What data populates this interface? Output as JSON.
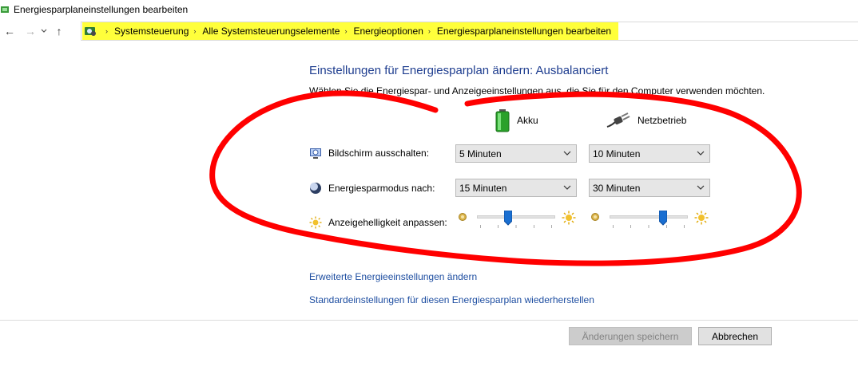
{
  "window": {
    "title": "Energiesparplaneinstellungen bearbeiten"
  },
  "nav": {
    "back": "←",
    "forward": "→",
    "recent": "⌄",
    "up": "↑"
  },
  "breadcrumb": {
    "items": [
      "Systemsteuerung",
      "Alle Systemsteuerungselemente",
      "Energieoptionen",
      "Energiesparplaneinstellungen bearbeiten"
    ],
    "separator": "›",
    "highlight_color": "#ffff3b"
  },
  "main": {
    "heading": "Einstellungen für Energiesparplan ändern: Ausbalanciert",
    "subheading": "Wählen Sie die Energiespar- und Anzeigeeinstellungen aus, die Sie für den Computer verwenden möchten.",
    "columns": {
      "battery": {
        "label": "Akku",
        "icon": "battery-icon"
      },
      "plugged": {
        "label": "Netzbetrieb",
        "icon": "power-plug-icon"
      }
    },
    "rows": {
      "display_off": {
        "label": "Bildschirm ausschalten:",
        "icon": "monitor-clock-icon",
        "battery": "5 Minuten",
        "plugged": "10 Minuten"
      },
      "sleep": {
        "label": "Energiesparmodus nach:",
        "icon": "moon-icon",
        "battery": "15 Minuten",
        "plugged": "30 Minuten"
      },
      "brightness": {
        "label": "Anzeigehelligkeit anpassen:",
        "icon": "sun-icon",
        "battery_level": 0.4,
        "plugged_level": 0.68
      }
    },
    "links": {
      "advanced": "Erweiterte Energieeinstellungen ändern",
      "restore": "Standardeinstellungen für diesen Energiesparplan wiederherstellen"
    }
  },
  "footer": {
    "save": "Änderungen speichern",
    "cancel": "Abbrechen"
  },
  "colors": {
    "heading": "#1e3d8f",
    "link": "#1e4ea1",
    "annotation": "#ff0000",
    "slider_thumb": "#1a6fd1"
  }
}
